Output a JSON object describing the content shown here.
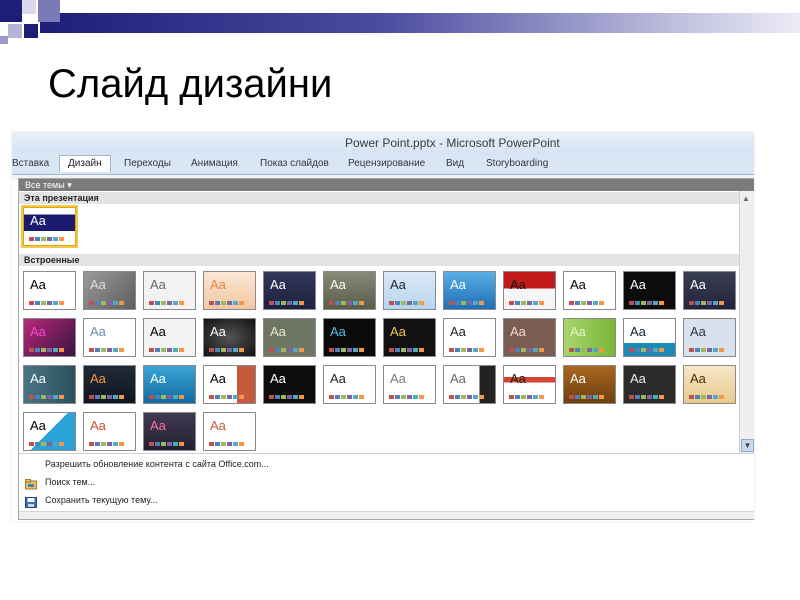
{
  "slide": {
    "title": "Слайд дизайни"
  },
  "window": {
    "title": "Power Point.pptx - Microsoft PowerPoint"
  },
  "ribbon": {
    "tabs": [
      {
        "label": "Вставка",
        "active": false
      },
      {
        "label": "Дизайн",
        "active": true
      },
      {
        "label": "Переходы",
        "active": false
      },
      {
        "label": "Анимация",
        "active": false
      },
      {
        "label": "Показ слайдов",
        "active": false
      },
      {
        "label": "Рецензирование",
        "active": false
      },
      {
        "label": "Вид",
        "active": false
      },
      {
        "label": "Storyboarding",
        "active": false
      }
    ]
  },
  "gallery": {
    "header": "Все темы ▾",
    "current_section": "Эта презентация",
    "builtin_section": "Встроенные",
    "theme_label": "Aa"
  },
  "menu": {
    "items": [
      {
        "label": "Разрешить обновление контента с сайта Office.com...",
        "icon": "none"
      },
      {
        "label": "Поиск тем...",
        "icon": "folder-icon"
      },
      {
        "label": "Сохранить текущую тему...",
        "icon": "save-theme-icon"
      }
    ]
  },
  "colors": {
    "selection": "#f2c94c",
    "title_bar": "#d6e3f3",
    "deco_dark": "#1e1e78"
  }
}
